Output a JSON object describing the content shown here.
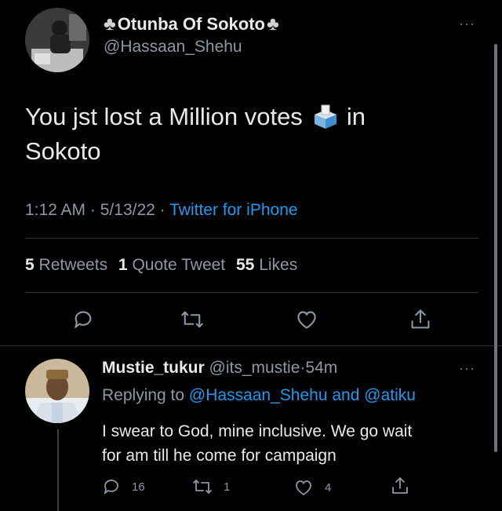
{
  "main_tweet": {
    "display_name": "Otunba Of Sokoto",
    "handle": "@Hassaan_Shehu",
    "text_line1": "You jst lost a Million votes",
    "text_after_emoji": "in",
    "text_line2": "Sokoto",
    "time": "1:12 AM",
    "date": "5/13/22",
    "source": "Twitter for iPhone",
    "sep": "·",
    "stats": {
      "retweets_count": "5",
      "retweets_label": "Retweets",
      "quotes_count": "1",
      "quotes_label": "Quote Tweet",
      "likes_count": "55",
      "likes_label": "Likes"
    },
    "more_label": "···"
  },
  "reply": {
    "display_name": "Mustie_tukur",
    "handle": "@its_mustie",
    "sep": "·",
    "age": "54m",
    "replying_prefix": "Replying to",
    "replying_user1": "@Hassaan_Shehu",
    "replying_and": "and",
    "replying_user2": "@atiku",
    "text_line1": "I swear to God, mine inclusive. We go wait",
    "text_line2": "for am till he come for campaign",
    "reply_count": "16",
    "retweet_count": "1",
    "like_count": "4",
    "more_label": "···"
  },
  "colors": {
    "background": "#000000",
    "text": "#e7e9ea",
    "muted": "#8b98a5",
    "accent": "#1d9bf0",
    "divider": "#2f3336"
  },
  "icons": [
    "club-suit-icon",
    "ballot-box-icon",
    "reply-icon",
    "retweet-icon",
    "like-icon",
    "share-icon",
    "more-icon"
  ]
}
